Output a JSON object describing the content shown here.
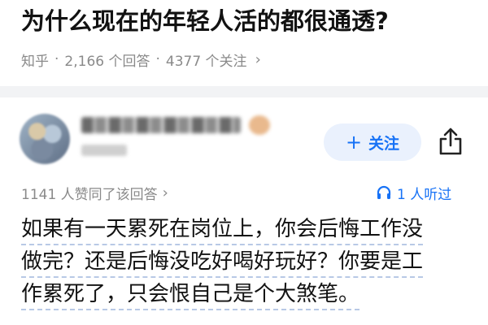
{
  "question": {
    "title": "为什么现在的年轻人活的都很通透?"
  },
  "meta": {
    "source": "知乎",
    "answers": "2,166 个回答",
    "followers": "4377 个关注"
  },
  "answer": {
    "upvote_text": "1141 人赞同了该回答",
    "listen_text": "1 人听过",
    "follow_label": "关注",
    "lines": [
      "如果有一天累死在岗位上，你会后悔工作没",
      "做完？还是后悔没吃好喝好玩好？你要是工",
      "作累死了，只会恨自己是个大煞笔。"
    ]
  },
  "colors": {
    "accent": "#1772f6",
    "follow_bg": "#eaf1fd",
    "meta_gray": "#8a8a8a"
  },
  "icons": {
    "share": "share-icon",
    "headphones": "headphones-icon",
    "chevron": "chevron-right-icon"
  }
}
